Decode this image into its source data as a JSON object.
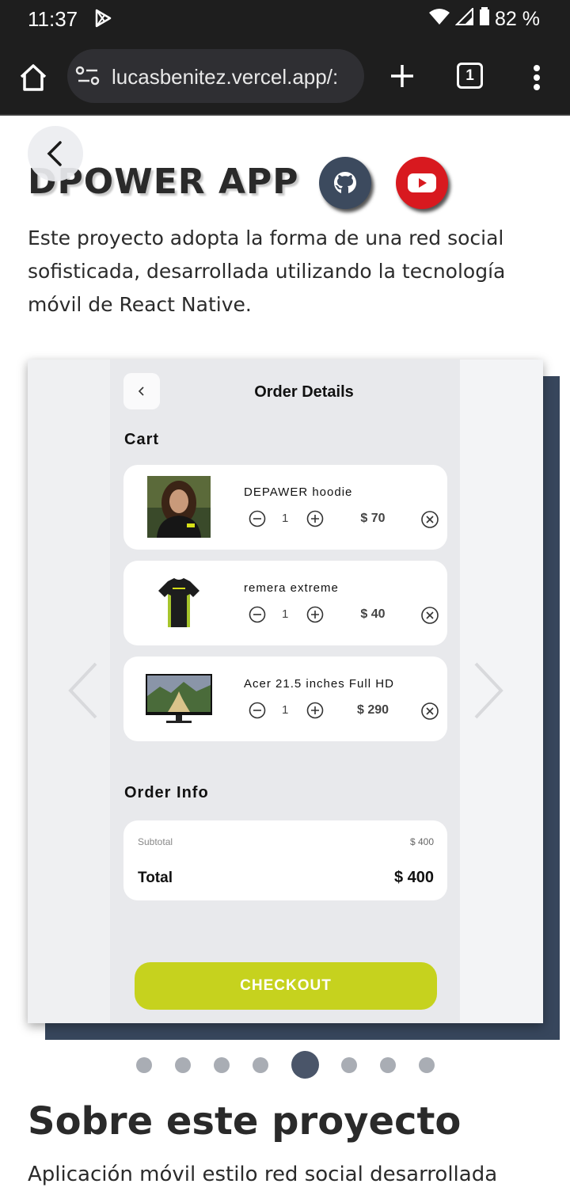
{
  "status_bar": {
    "time": "11:37",
    "battery": "82 %"
  },
  "browser": {
    "url": "lucasbenitez.vercel.app/:",
    "tab_count": "1"
  },
  "project": {
    "title": "DPOWER APP",
    "description": "Este proyecto adopta la forma de una red social sofisticada, desarrollada utilizando la tecnología móvil de React Native."
  },
  "order": {
    "title": "Order Details",
    "cart_heading": "Cart",
    "items": [
      {
        "name": "DEPAWER hoodie",
        "qty": "1",
        "price": "$ 70"
      },
      {
        "name": "remera extreme",
        "qty": "1",
        "price": "$ 40"
      },
      {
        "name": "Acer 21.5 inches Full HD",
        "qty": "1",
        "price": "$ 290"
      }
    ],
    "info_heading": "Order Info",
    "subtotal_label": "Subtotal",
    "subtotal_value": "$ 400",
    "total_label": "Total",
    "total_value": "$ 400",
    "checkout_label": "CHECKOUT"
  },
  "carousel": {
    "dot_count": 8,
    "active_index": 4
  },
  "about": {
    "heading": "Sobre este proyecto",
    "text": "Aplicación móvil estilo red social desarrollada"
  },
  "colors": {
    "checkout": "#c6d21e",
    "github": "#3c4a5e",
    "youtube": "#d8191f",
    "navy": "#37465c"
  }
}
